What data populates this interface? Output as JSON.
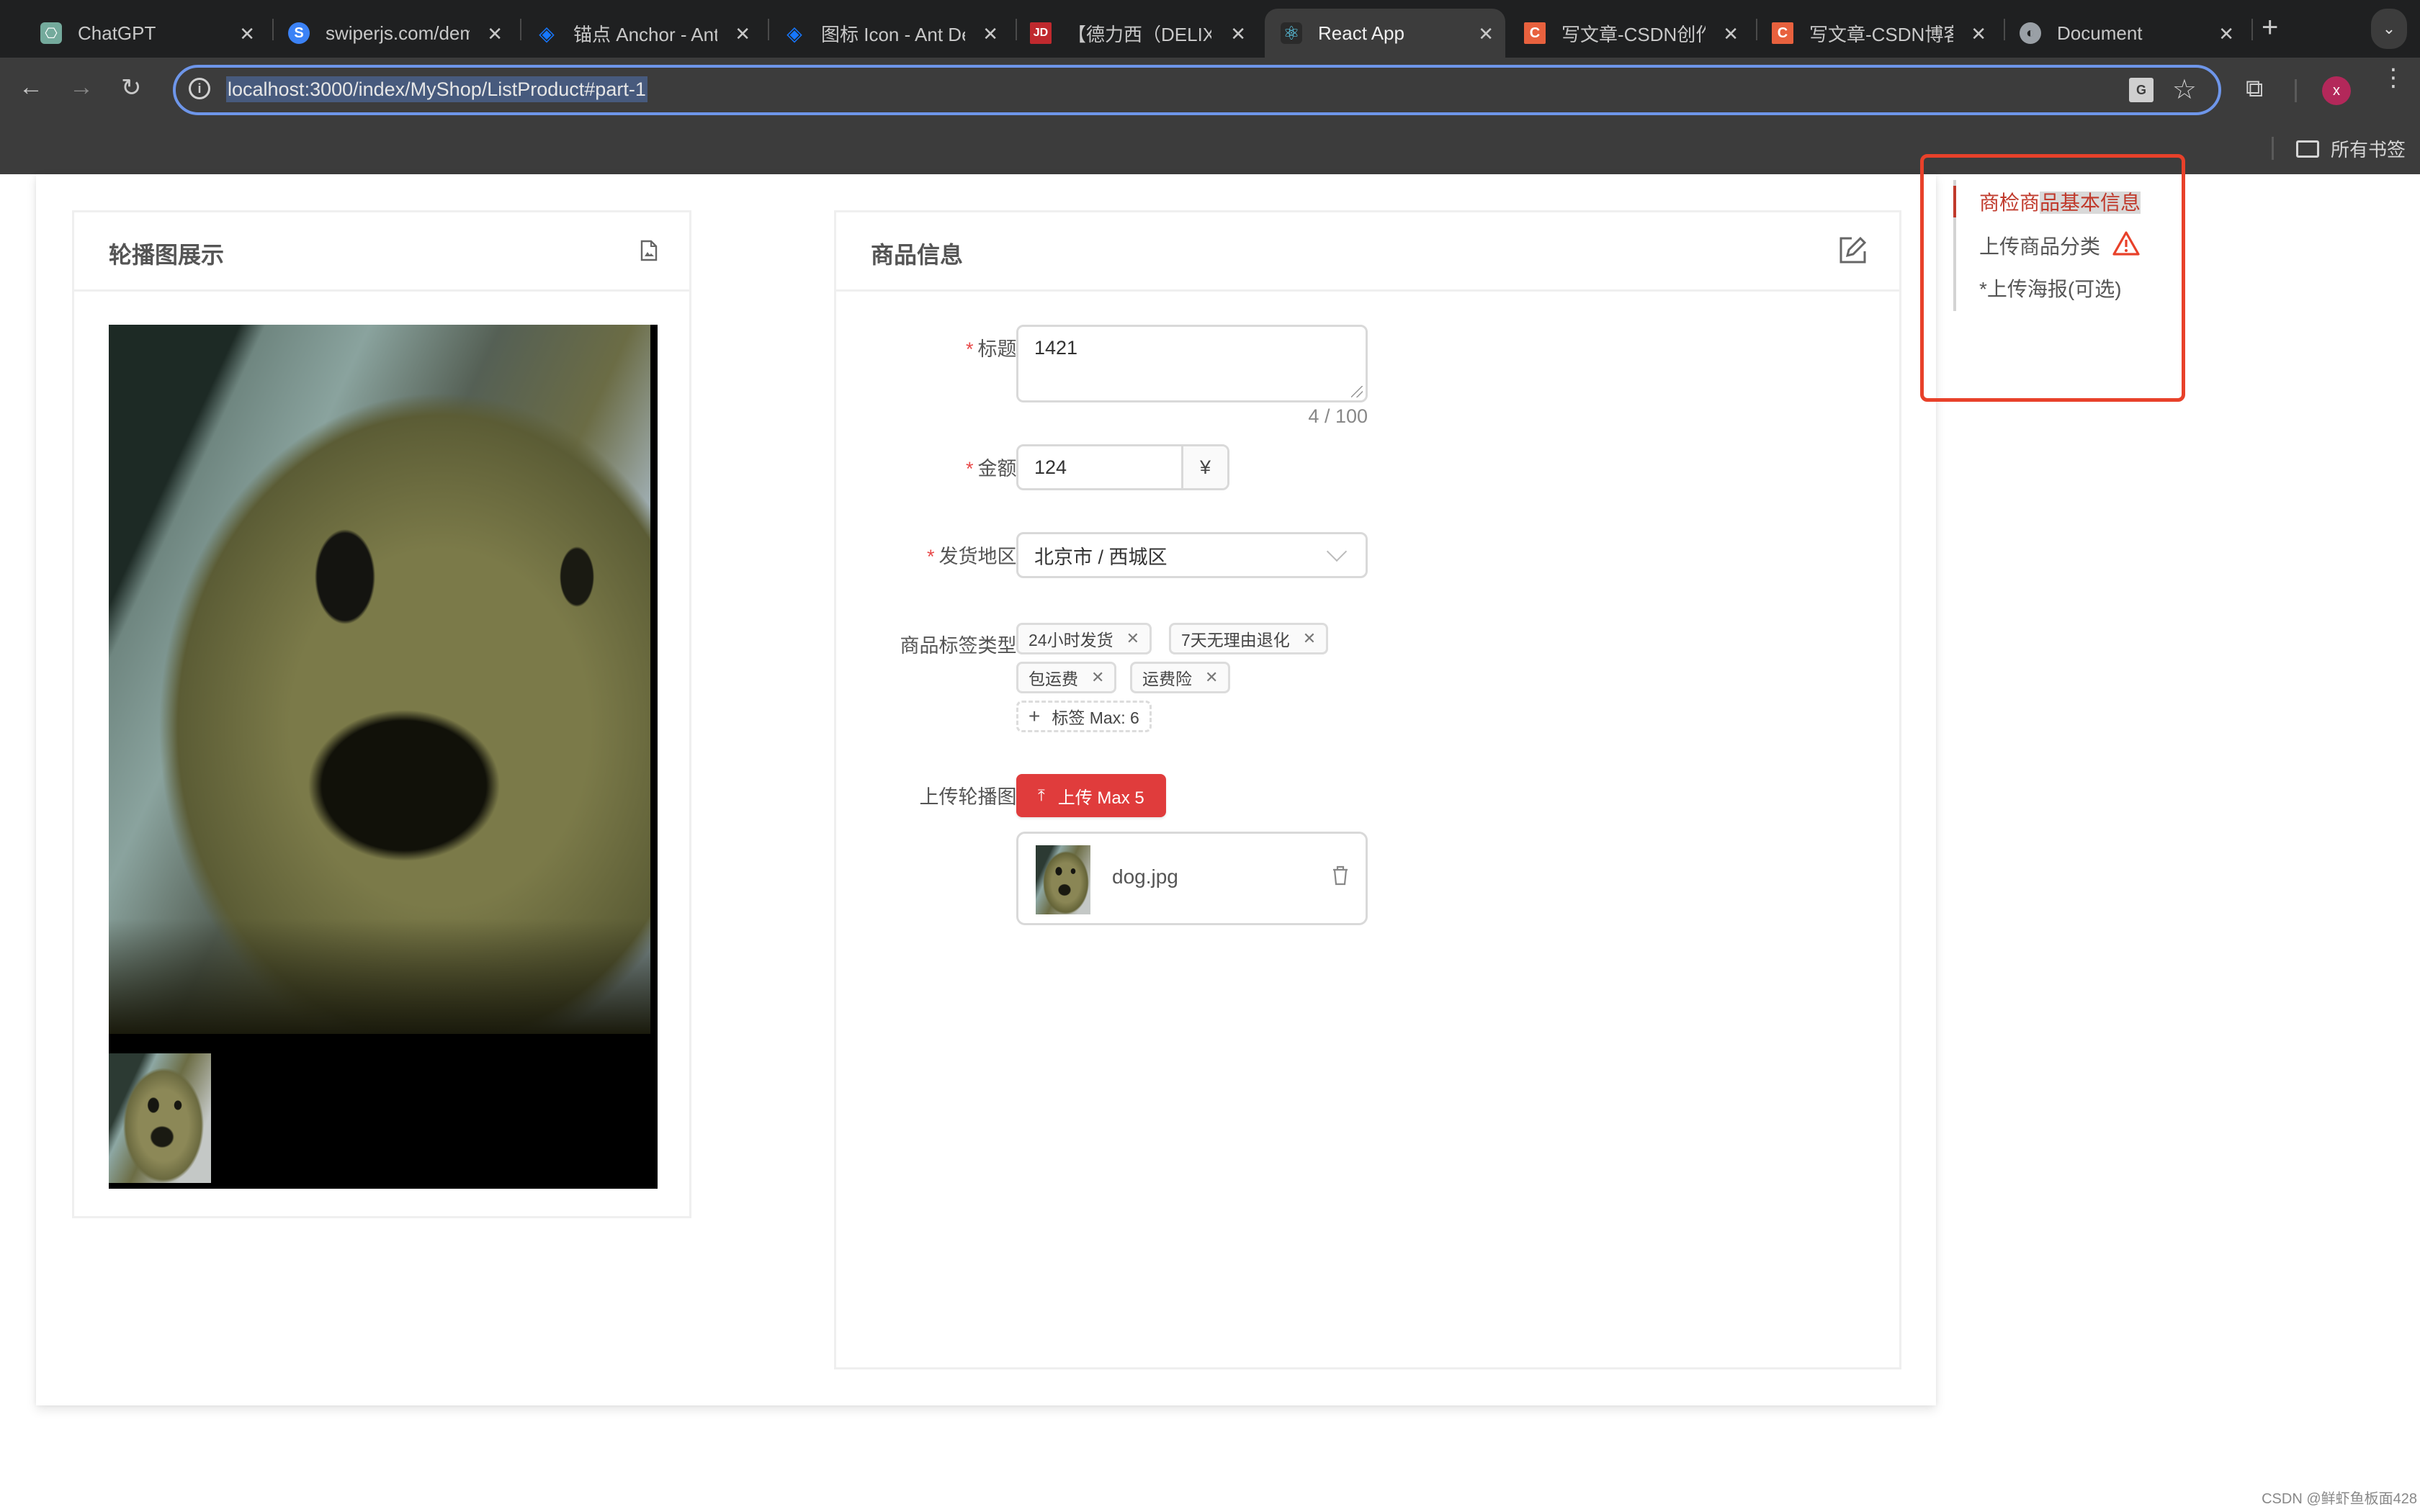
{
  "browser": {
    "tabs": [
      {
        "title": "ChatGPT",
        "icon": "chatgpt-icon",
        "color": "#74aa9c",
        "active": false
      },
      {
        "title": "swiperjs.com/demos",
        "icon": "swiper-icon",
        "color": "#3b82f6",
        "active": false
      },
      {
        "title": "锚点 Anchor - Ant Design",
        "icon": "antd-icon",
        "color": "#1677ff",
        "active": false
      },
      {
        "title": "图标 Icon - Ant Design",
        "icon": "antd-icon",
        "color": "#1677ff",
        "active": false
      },
      {
        "title": "【德力西（DELIXI）",
        "icon": "jd-icon",
        "color": "#c0292e",
        "active": false
      },
      {
        "title": "React App",
        "icon": "react-icon",
        "color": "#61dafb",
        "active": true
      },
      {
        "title": "写文章-CSDN创作中心",
        "icon": "csdn-icon",
        "color": "#e8613e",
        "active": false
      },
      {
        "title": "写文章-CSDN博客",
        "icon": "csdn-icon",
        "color": "#e8613e",
        "active": false
      },
      {
        "title": "Document",
        "icon": "globe-icon",
        "color": "#9aa0a6",
        "active": false
      }
    ],
    "url": "localhost:3000/index/MyShop/ListProduct#part-1",
    "profile_initial": "x",
    "bookmarks_label": "所有书签",
    "glyphs": {
      "close": "✕",
      "new_tab": "+",
      "tab_menu": "⌄",
      "back": "←",
      "forward": "→",
      "reload": "↻",
      "info": "i",
      "translate": "G",
      "star": "☆",
      "extensions": "⧉",
      "kebab": "⋮"
    }
  },
  "carousel_card": {
    "title": "轮播图展示",
    "icon": "file-image-icon"
  },
  "product_card": {
    "title": "商品信息",
    "icon": "edit-icon",
    "form": {
      "title_label": "标题",
      "title_value": "1421",
      "title_count": "4 / 100",
      "amount_label": "金额",
      "amount_value": "124",
      "amount_suffix": "¥",
      "region_label": "发货地区",
      "region_value": "北京市 / 西城区",
      "tags_label": "商品标签类型",
      "tags": [
        "24小时发货",
        "7天无理由退化",
        "包运费",
        "运费险"
      ],
      "add_tag_label": "标签 Max: 6",
      "upload_label": "上传轮播图",
      "upload_button": "上传 Max 5",
      "files": [
        {
          "name": "dog.jpg"
        }
      ],
      "required_mark": "*",
      "colon": ":",
      "tag_close": "✕",
      "plus": "+",
      "upload_glyph": "⤒"
    }
  },
  "anchor_nav": {
    "links": [
      {
        "prefix": "商检商",
        "highlight": "品基本信息",
        "active": true
      },
      {
        "text": "上传商品分类",
        "warning": true,
        "active": false
      },
      {
        "text": "*上传海报(可选)",
        "active": false
      }
    ]
  },
  "theme": {
    "primary": "#e03c3c",
    "anchor_active": "#c0392b",
    "annotation_box": "#e8412a"
  },
  "watermark": "CSDN @鲜虾鱼板面428"
}
